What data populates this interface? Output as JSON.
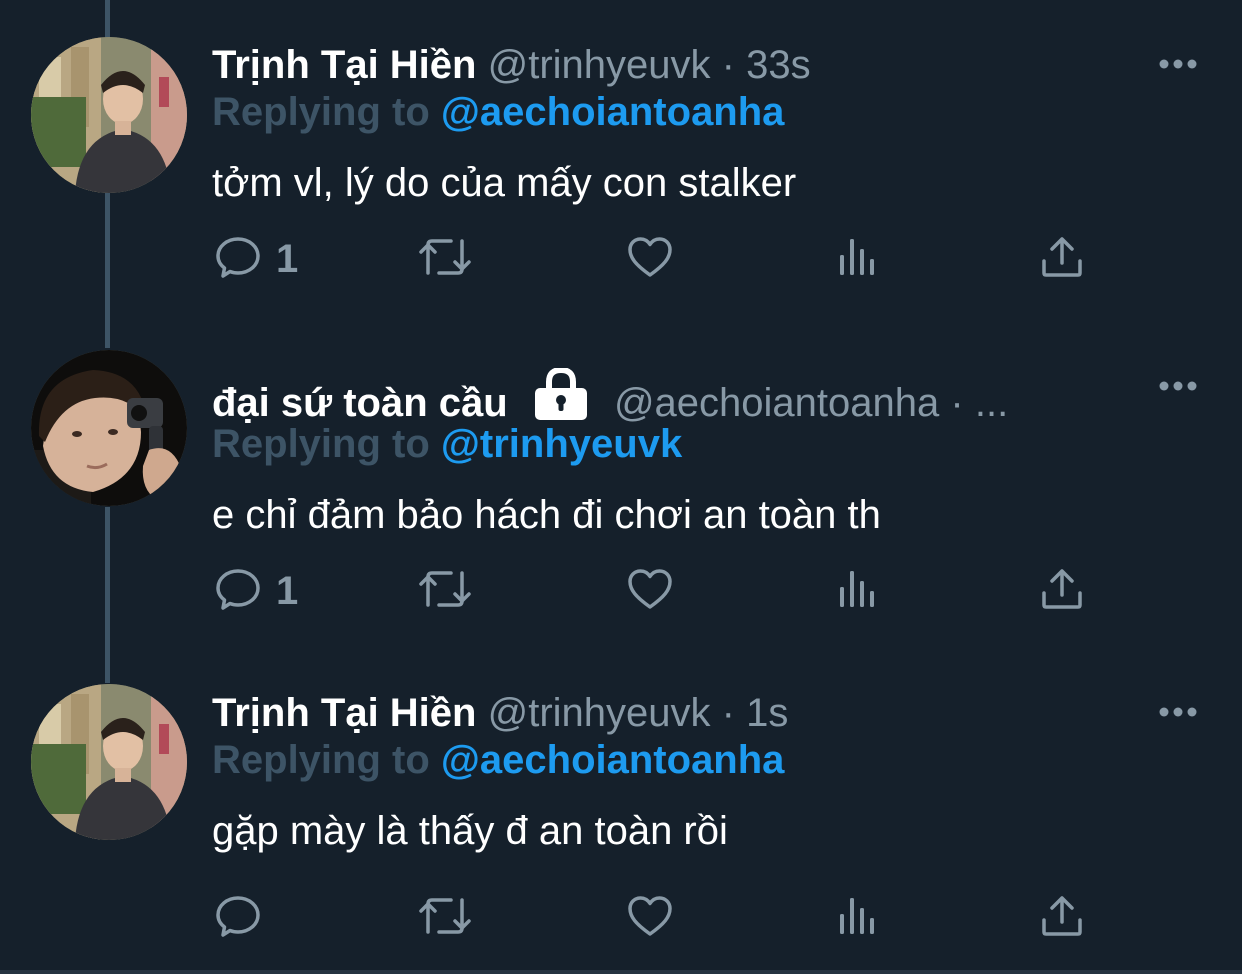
{
  "tweets": [
    {
      "name": "Trịnh Tại Hiền",
      "handle": "@trinhyeuvk",
      "separator": "·",
      "time": "33s",
      "reply_prefix": "Replying to",
      "reply_handle": "@aechoiantoanha",
      "text": "tởm vl, lý do của mấy con stalker",
      "reply_count": "1",
      "protected": false
    },
    {
      "name": "đại sứ toàn cầu",
      "handle": "@aechoiantoanha",
      "separator": "·",
      "time": "...",
      "reply_prefix": "Replying to",
      "reply_handle": "@trinhyeuvk",
      "text": "e chỉ đảm bảo hách đi chơi an toàn th",
      "reply_count": "1",
      "protected": true
    },
    {
      "name": "Trịnh Tại Hiền",
      "handle": "@trinhyeuvk",
      "separator": "·",
      "time": "1s",
      "reply_prefix": "Replying to",
      "reply_handle": "@aechoiantoanha",
      "text": "gặp mày là thấy đ an toàn rồi",
      "reply_count": "",
      "protected": false
    }
  ],
  "colors": {
    "background": "#15202b",
    "name": "#ffffff",
    "secondary": "#8899a6",
    "link": "#1d9bf0",
    "thread_line": "#3d5466"
  },
  "icons": {
    "more": "more-dots-icon",
    "reply": "reply-bubble-icon",
    "retweet": "retweet-icon",
    "like": "heart-icon",
    "analytics": "analytics-bars-icon",
    "share": "share-upload-icon",
    "protected": "lock-icon"
  }
}
